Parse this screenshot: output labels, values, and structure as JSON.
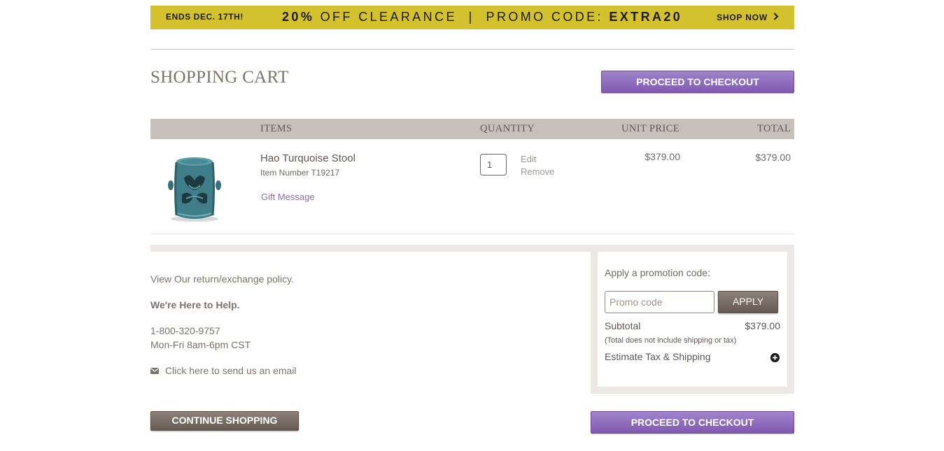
{
  "banner": {
    "ends": "ENDS DEC. 17TH!",
    "headline_pct": "20%",
    "headline_text": " OFF CLEARANCE  |  PROMO CODE: ",
    "promo_code": "EXTRA20",
    "shop_now": "SHOP NOW",
    "background": "#d3c12e"
  },
  "page": {
    "title": "SHOPPING CART",
    "checkout_label": "PROCEED TO CHECKOUT",
    "accent_color": "#8a64b8"
  },
  "cart": {
    "columns": {
      "items": "ITEMS",
      "quantity": "QUANTITY",
      "unit_price": "UNIT PRICE",
      "total": "TOTAL"
    },
    "item": {
      "name": "Hao Turquoise Stool",
      "item_number": "Item Number T19217",
      "gift_message": "Gift Message",
      "quantity": "1",
      "edit": "Edit",
      "remove": "Remove",
      "unit_price": "$379.00",
      "total": "$379.00",
      "image_icon": "turquoise-garden-stool"
    }
  },
  "help": {
    "return_policy": "View Our return/exchange policy.",
    "heading": "We're Here to Help.",
    "phone": "1-800-320-9757",
    "hours": "Mon-Fri 8am-6pm CST",
    "email": "Click here to send us an email",
    "email_icon": "envelope-icon"
  },
  "summary": {
    "promo_label": "Apply a promotion code:",
    "promo_placeholder": "Promo code",
    "apply": "APPLY",
    "subtotal_label": "Subtotal",
    "subtotal_value": "$379.00",
    "subtotal_note": "(Total does not include shipping or tax)",
    "estimate": "Estimate Tax & Shipping",
    "estimate_icon": "plus-circle-icon"
  },
  "footer": {
    "continue": "CONTINUE SHOPPING"
  }
}
